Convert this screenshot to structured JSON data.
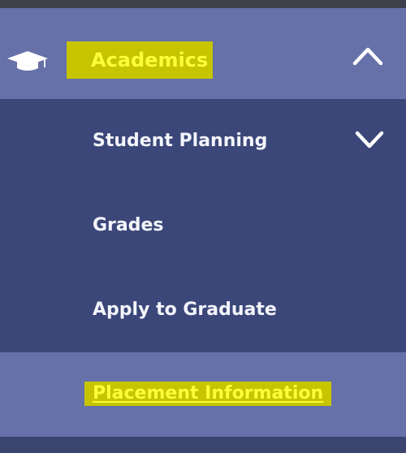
{
  "menu": {
    "section": {
      "label": "Academics",
      "icon": "graduation-cap-icon",
      "toggle_icon": "chevron-up-icon",
      "expanded": true
    },
    "items": [
      {
        "label": "Student Planning",
        "icon": "chevron-down-icon"
      },
      {
        "label": "Grades"
      },
      {
        "label": "Apply to Graduate"
      },
      {
        "label": "Placement Information",
        "highlighted": true
      }
    ]
  },
  "colors": {
    "section_bg": "#6671a9",
    "submenu_bg": "#3b4779",
    "highlight_bg": "#c6c500",
    "highlight_text": "#fdfd3a",
    "text": "#f4f5fb"
  }
}
